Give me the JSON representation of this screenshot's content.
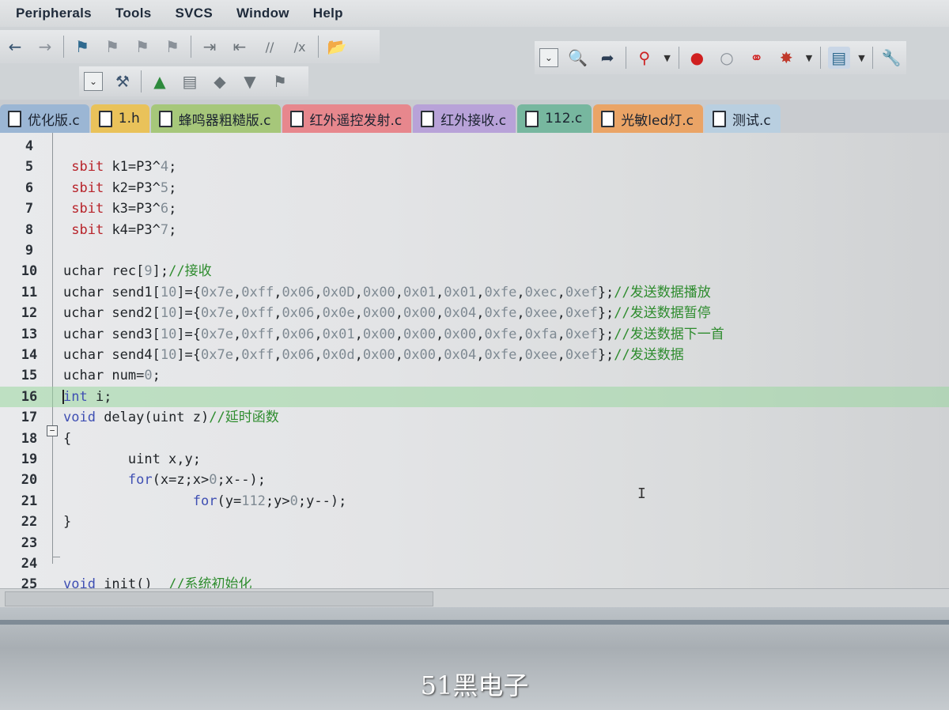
{
  "menu": [
    "Peripherals",
    "Tools",
    "SVCS",
    "Window",
    "Help"
  ],
  "tabs": [
    {
      "label": "优化版.c",
      "color": "#9bb6d4"
    },
    {
      "label": "1.h",
      "color": "#e9c25a"
    },
    {
      "label": "蜂鸣器粗糙版.c",
      "color": "#a6c77a"
    },
    {
      "label": "红外遥控发射.c",
      "color": "#e7878d"
    },
    {
      "label": "红外接收.c",
      "color": "#b8a2d8"
    },
    {
      "label": "112.c",
      "color": "#77b79f"
    },
    {
      "label": "光敏led灯.c",
      "color": "#eaa466"
    },
    {
      "label": "测试.c",
      "color": "#b9cfe0"
    }
  ],
  "toolbar_icons": {
    "row1": [
      "back-arrow-icon",
      "forward-arrow-icon",
      "bookmark-icon",
      "prev-bookmark-icon",
      "next-bookmark-icon",
      "clear-bookmarks-icon",
      "indent-icon",
      "unindent-icon",
      "comment-icon",
      "uncomment-icon",
      "open-file-icon"
    ],
    "row2": [
      "dropdown-icon",
      "find-in-files-icon",
      "incremental-find-icon",
      "debug-session-icon",
      "breakpoint-icon",
      "disabled-breakpoint-icon",
      "clear-breakpoints-icon",
      "kill-breakpoints-icon",
      "window-layout-icon",
      "configure-icon"
    ],
    "row3": [
      "dropdown-icon",
      "options-icon",
      "manage-components-icon",
      "select-packs-icon",
      "pack-installer-icon",
      "validate-icon",
      "build-icon"
    ]
  },
  "code_lines": [
    {
      "n": "4",
      "html": ""
    },
    {
      "n": "5",
      "html": " <span class=\"sb\">sbit</span> k1=P3^<span class=\"num\">4</span>;"
    },
    {
      "n": "6",
      "html": " <span class=\"sb\">sbit</span> k2=P3^<span class=\"num\">5</span>;"
    },
    {
      "n": "7",
      "html": " <span class=\"sb\">sbit</span> k3=P3^<span class=\"num\">6</span>;"
    },
    {
      "n": "8",
      "html": " <span class=\"sb\">sbit</span> k4=P3^<span class=\"num\">7</span>;"
    },
    {
      "n": "9",
      "html": ""
    },
    {
      "n": "10",
      "html": "uchar rec[<span class=\"num\">9</span>];<span class=\"cm\">//接收</span>"
    },
    {
      "n": "11",
      "html": "uchar send1[<span class=\"num\">10</span>]={<span class=\"num\">0x7e</span>,<span class=\"num\">0xff</span>,<span class=\"num\">0x06</span>,<span class=\"num\">0x0D</span>,<span class=\"num\">0x00</span>,<span class=\"num\">0x01</span>,<span class=\"num\">0x01</span>,<span class=\"num\">0xfe</span>,<span class=\"num\">0xec</span>,<span class=\"num\">0xef</span>};<span class=\"cm\">//发送数据播放</span>"
    },
    {
      "n": "12",
      "html": "uchar send2[<span class=\"num\">10</span>]={<span class=\"num\">0x7e</span>,<span class=\"num\">0xff</span>,<span class=\"num\">0x06</span>,<span class=\"num\">0x0e</span>,<span class=\"num\">0x00</span>,<span class=\"num\">0x00</span>,<span class=\"num\">0x04</span>,<span class=\"num\">0xfe</span>,<span class=\"num\">0xee</span>,<span class=\"num\">0xef</span>};<span class=\"cm\">//发送数据暂停</span>"
    },
    {
      "n": "13",
      "html": "uchar send3[<span class=\"num\">10</span>]={<span class=\"num\">0x7e</span>,<span class=\"num\">0xff</span>,<span class=\"num\">0x06</span>,<span class=\"num\">0x01</span>,<span class=\"num\">0x00</span>,<span class=\"num\">0x00</span>,<span class=\"num\">0x00</span>,<span class=\"num\">0xfe</span>,<span class=\"num\">0xfa</span>,<span class=\"num\">0xef</span>};<span class=\"cm\">//发送数据下一首</span>"
    },
    {
      "n": "14",
      "html": "uchar send4[<span class=\"num\">10</span>]={<span class=\"num\">0x7e</span>,<span class=\"num\">0xff</span>,<span class=\"num\">0x06</span>,<span class=\"num\">0x0d</span>,<span class=\"num\">0x00</span>,<span class=\"num\">0x00</span>,<span class=\"num\">0x04</span>,<span class=\"num\">0xfe</span>,<span class=\"num\">0xee</span>,<span class=\"num\">0xef</span>};<span class=\"cm\">//发送数据</span>"
    },
    {
      "n": "15",
      "html": "uchar num=<span class=\"num\">0</span>;"
    },
    {
      "n": "16",
      "html": "<span class=\"kw\">int</span> i;",
      "highlight": true
    },
    {
      "n": "17",
      "html": "<span class=\"kw\">void</span> delay(uint z)<span class=\"cm\">//延时函数</span>"
    },
    {
      "n": "18",
      "html": "{"
    },
    {
      "n": "19",
      "html": "        uint x,y;"
    },
    {
      "n": "20",
      "html": "        <span class=\"kw\">for</span>(x=z;x&gt;<span class=\"num\">0</span>;x--);"
    },
    {
      "n": "21",
      "html": "                <span class=\"kw\">for</span>(y=<span class=\"num\">112</span>;y&gt;<span class=\"num\">0</span>;y--);"
    },
    {
      "n": "22",
      "html": "}"
    },
    {
      "n": "23",
      "html": ""
    },
    {
      "n": "24",
      "html": ""
    },
    {
      "n": "25",
      "html": "<span class=\"kw\">void</span> init()  <span class=\"cm\">//系统初始化</span>"
    }
  ],
  "fold_marker": "−",
  "watermark": "51黑电子"
}
